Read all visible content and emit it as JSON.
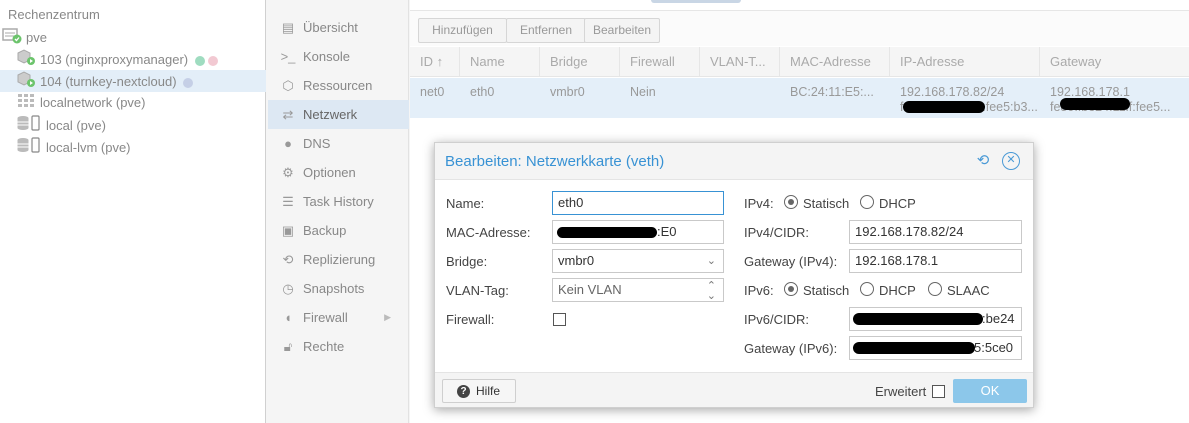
{
  "tree": {
    "items": [
      {
        "label": "Rechenzentrum"
      },
      {
        "label": "pve"
      },
      {
        "label": "103 (nginxproxymanager)"
      },
      {
        "label": "104 (turnkey-nextcloud)"
      },
      {
        "label": "localnetwork (pve)"
      },
      {
        "label": "local (pve)"
      },
      {
        "label": "local-lvm (pve)"
      }
    ]
  },
  "menu": {
    "items": [
      {
        "label": "Übersicht",
        "icon": "document-icon"
      },
      {
        "label": "Konsole",
        "icon": "terminal-icon"
      },
      {
        "label": "Ressourcen",
        "icon": "cube-icon"
      },
      {
        "label": "Netzwerk",
        "icon": "exchange-icon"
      },
      {
        "label": "DNS",
        "icon": "globe-icon"
      },
      {
        "label": "Optionen",
        "icon": "gear-icon"
      },
      {
        "label": "Task History",
        "icon": "list-icon"
      },
      {
        "label": "Backup",
        "icon": "save-icon"
      },
      {
        "label": "Replizierung",
        "icon": "retweet-icon"
      },
      {
        "label": "Snapshots",
        "icon": "history-icon"
      },
      {
        "label": "Firewall",
        "icon": "shield-icon"
      },
      {
        "label": "Rechte",
        "icon": "unlock-icon"
      }
    ]
  },
  "toolbar": {
    "add_label": "Hinzufügen",
    "remove_label": "Entfernen",
    "edit_label": "Bearbeiten"
  },
  "grid": {
    "headers": [
      "ID ↑",
      "Name",
      "Bridge",
      "Firewall",
      "VLAN-T...",
      "MAC-Adresse",
      "IP-Adresse",
      "Gateway"
    ],
    "row": {
      "id": "net0",
      "name": "eth0",
      "bridge": "vmbr0",
      "firewall": "Nein",
      "vlan": "",
      "mac": "BC:24:11:E5:...",
      "ip_line1": "192.168.178.82/24",
      "ip_line2": "fe80::be24:11ff:fee5:b3...",
      "gw_line1": "192.168.178.1",
      "gw_line2": "fe80::be24:11ff:fee5..."
    }
  },
  "dialog": {
    "title": "Bearbeiten: Netzwerkkarte (veth)",
    "left": {
      "name_label": "Name:",
      "name_value": "eth0",
      "mac_label": "MAC-Adresse:",
      "mac_value_suffix": ":E0",
      "bridge_label": "Bridge:",
      "bridge_value": "vmbr0",
      "vlan_label": "VLAN-Tag:",
      "vlan_value": "Kein VLAN",
      "firewall_label": "Firewall:"
    },
    "right": {
      "ipv4_label": "IPv4:",
      "ipv4_static": "Statisch",
      "ipv4_dhcp": "DHCP",
      "ipv4_cidr_label": "IPv4/CIDR:",
      "ipv4_cidr_value": "192.168.178.82/24",
      "gw4_label": "Gateway (IPv4):",
      "gw4_value": "192.168.178.1",
      "ipv6_label": "IPv6:",
      "ipv6_static": "Statisch",
      "ipv6_dhcp": "DHCP",
      "ipv6_slaac": "SLAAC",
      "ipv6_cidr_label": "IPv6/CIDR:",
      "ipv6_cidr_suffix": ":be24",
      "gw6_label": "Gateway (IPv6):",
      "gw6_suffix": "5:5ce0"
    },
    "footer": {
      "help_label": "Hilfe",
      "advanced_label": "Erweitert",
      "ok_label": "OK"
    }
  },
  "colors": {
    "accent": "#3892d4",
    "ok_button": "#8cc7ea",
    "selected_row": "#e4eff9",
    "status_green": "#9fdcc0",
    "status_pink": "#f2c9d2",
    "status_blue": "#c5cfe6"
  }
}
